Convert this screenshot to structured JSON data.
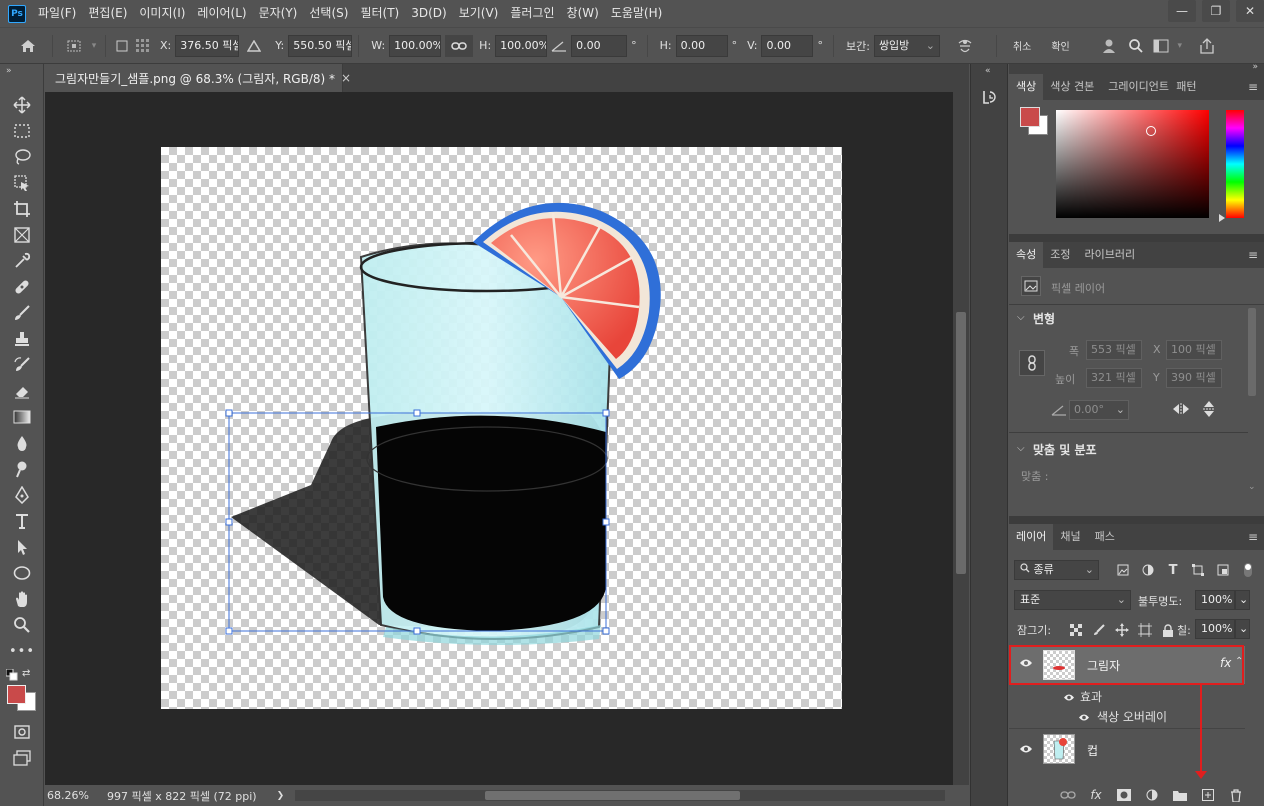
{
  "menubar": {
    "logo": "Ps",
    "items": [
      "파일(F)",
      "편집(E)",
      "이미지(I)",
      "레이어(L)",
      "문자(Y)",
      "선택(S)",
      "필터(T)",
      "3D(D)",
      "보기(V)",
      "플러그인",
      "창(W)",
      "도움말(H)"
    ],
    "window_controls": [
      "—",
      "❐",
      "✕"
    ]
  },
  "options": {
    "x_label": "X:",
    "x_value": "376.50 픽셀",
    "y_label": "Y:",
    "y_value": "550.50 픽셀",
    "w_label": "W:",
    "w_value": "100.00%",
    "h_label": "H:",
    "h_value": "100.00%",
    "angle_value": "0.00",
    "degree": "°",
    "hskew_label": "H:",
    "hskew_value": "0.00",
    "vskew_label": "V:",
    "vskew_value": "0.00",
    "interp_label": "보간:",
    "interp_value": "쌍입방",
    "cancel_label": "취소",
    "confirm_label": "확인"
  },
  "document": {
    "tab_title": "그림자만들기_샘플.png @ 68.3% (그림자, RGB/8) *",
    "close": "×",
    "status_zoom": "68.26%",
    "status_info": "997 픽셀 x 822 픽셀 (72 ppi)",
    "status_arrow": "❯"
  },
  "color_panel": {
    "tabs": [
      "색상",
      "색상 견본",
      "그레이디언트",
      "패턴"
    ],
    "active_tab": "색상",
    "foreground_color": "#c94a4a",
    "background_color": "#ffffff"
  },
  "properties_panel": {
    "tabs": [
      "속성",
      "조정",
      "라이브러리"
    ],
    "active_tab": "속성",
    "layer_type": "픽셀 레이어",
    "transform_title": "변형",
    "width_label": "폭",
    "width_value": "553 픽셀",
    "x_label": "X",
    "x_value": "100 픽셀",
    "height_label": "높이",
    "height_value": "321 픽셀",
    "y_label": "Y",
    "y_value": "390 픽셀",
    "angle_value": "0.00°",
    "align_title": "맞춤 및 분포",
    "align_label": "맞춤 :"
  },
  "layers_panel": {
    "tabs": [
      "레이어",
      "채널",
      "패스"
    ],
    "active_tab": "레이어",
    "filter_value": "종류",
    "blend_mode": "표준",
    "opacity_label": "불투명도:",
    "opacity_value": "100%",
    "lock_label": "잠그기:",
    "fill_label": "칠:",
    "fill_value": "100%",
    "layers": [
      {
        "name": "그림자",
        "selected": true,
        "fx": "fx"
      },
      {
        "name": "컵",
        "selected": false
      }
    ],
    "effects_label": "효과",
    "effect_item": "색상 오버레이"
  },
  "colors": {
    "highlight_red": "#e01e1e",
    "selection_blue": "#3b6fd8"
  }
}
